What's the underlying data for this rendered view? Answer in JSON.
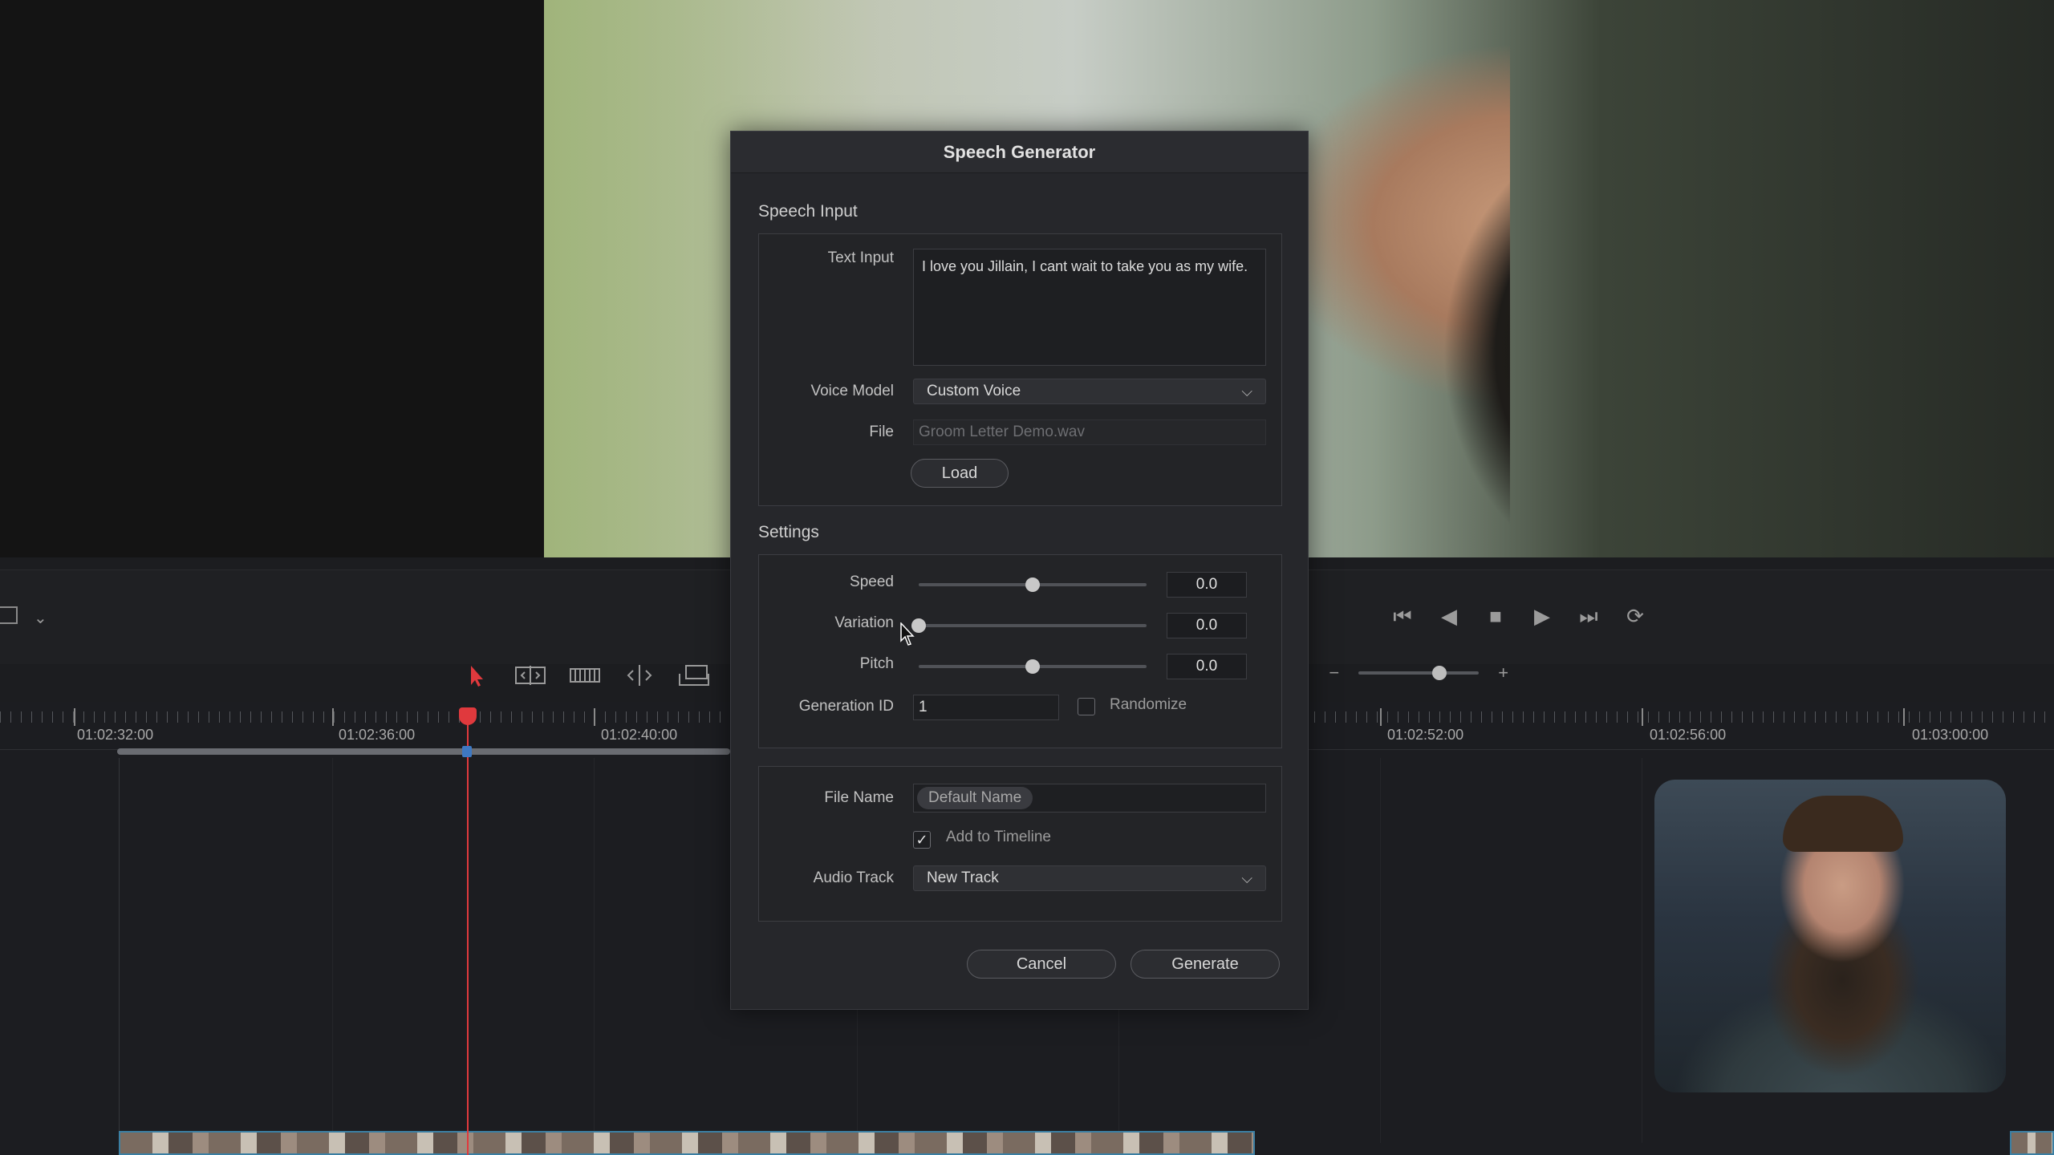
{
  "dialog": {
    "title": "Speech Generator",
    "speech_input": {
      "section_label": "Speech Input",
      "text_input_label": "Text Input",
      "text_input_value": "I love you Jillain, I cant wait to take you as my wife.",
      "voice_model_label": "Voice Model",
      "voice_model_value": "Custom Voice",
      "file_label": "File",
      "file_value": "Groom Letter Demo.wav",
      "load_button": "Load"
    },
    "settings": {
      "section_label": "Settings",
      "speed_label": "Speed",
      "speed_value": "0.0",
      "speed_level": 0.5,
      "variation_label": "Variation",
      "variation_value": "0.0",
      "variation_level": 0.0,
      "pitch_label": "Pitch",
      "pitch_value": "0.0",
      "pitch_level": 0.5,
      "generation_id_label": "Generation ID",
      "generation_id_value": "1",
      "randomize_label": "Randomize",
      "randomize_checked": false
    },
    "output": {
      "file_name_label": "File Name",
      "file_name_chip": "Default Name",
      "add_to_timeline_label": "Add to Timeline",
      "add_to_timeline_checked": true,
      "audio_track_label": "Audio Track",
      "audio_track_value": "New Track"
    },
    "cancel_button": "Cancel",
    "generate_button": "Generate"
  },
  "timeline": {
    "timecodes": [
      "01:02:32:00",
      "01:02:36:00",
      "01:02:40:00",
      "01:02:52:00",
      "01:02:56:00",
      "01:03:00:00"
    ]
  },
  "icons": {
    "transport": [
      "skip-to-start-icon",
      "step-back-icon",
      "stop-icon",
      "play-icon",
      "skip-to-end-icon",
      "loop-icon"
    ],
    "tools": [
      "selection-arrow-icon",
      "trim-edit-icon",
      "dynamic-trim-icon",
      "blade-icon",
      "insert-clip-icon"
    ]
  },
  "colors": {
    "playhead": "#e0393d",
    "selection_tool": "#e0393d",
    "clip_border": "#3b7fa3"
  }
}
